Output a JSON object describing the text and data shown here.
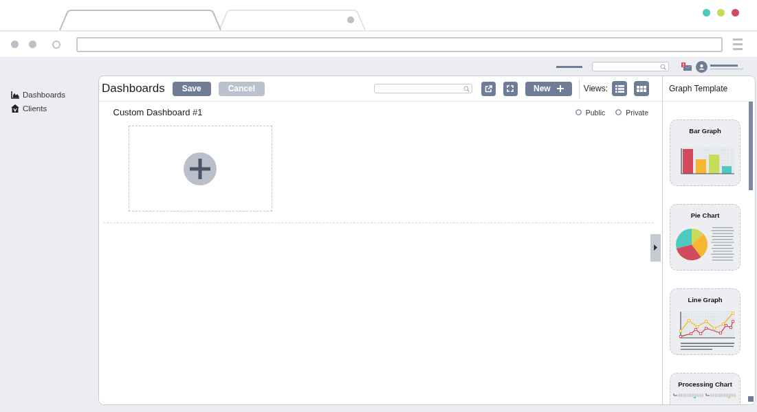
{
  "browser": {
    "tabs": [
      {
        "selected": true
      },
      {
        "selected": false
      }
    ],
    "window_buttons": [
      {
        "color": "#4fc9c0"
      },
      {
        "color": "#c8dc5c"
      },
      {
        "color": "#d24a5c"
      }
    ]
  },
  "sidebar": {
    "items": [
      {
        "label": "Dashboards"
      },
      {
        "label": "Clients"
      }
    ]
  },
  "toolbar": {
    "title": "Dashboards",
    "buttons": [
      {
        "label": "Save",
        "disabled": false
      },
      {
        "label": "Cancel",
        "disabled": true
      }
    ],
    "new_button": {
      "label": "New"
    },
    "views_label": "Views:"
  },
  "dashboard": {
    "name": "Custom Dashboard #1",
    "visibility": [
      {
        "label": "Public",
        "selected": false
      },
      {
        "label": "Private",
        "selected": false
      }
    ]
  },
  "graph_templates": {
    "title": "Graph Template",
    "cards": [
      {
        "kind": "bar",
        "title": "Bar Graph"
      },
      {
        "kind": "pie",
        "title": "Pie Chart"
      },
      {
        "kind": "line",
        "title": "Line Graph"
      },
      {
        "kind": "processing",
        "title": "Processing Chart"
      }
    ]
  }
}
